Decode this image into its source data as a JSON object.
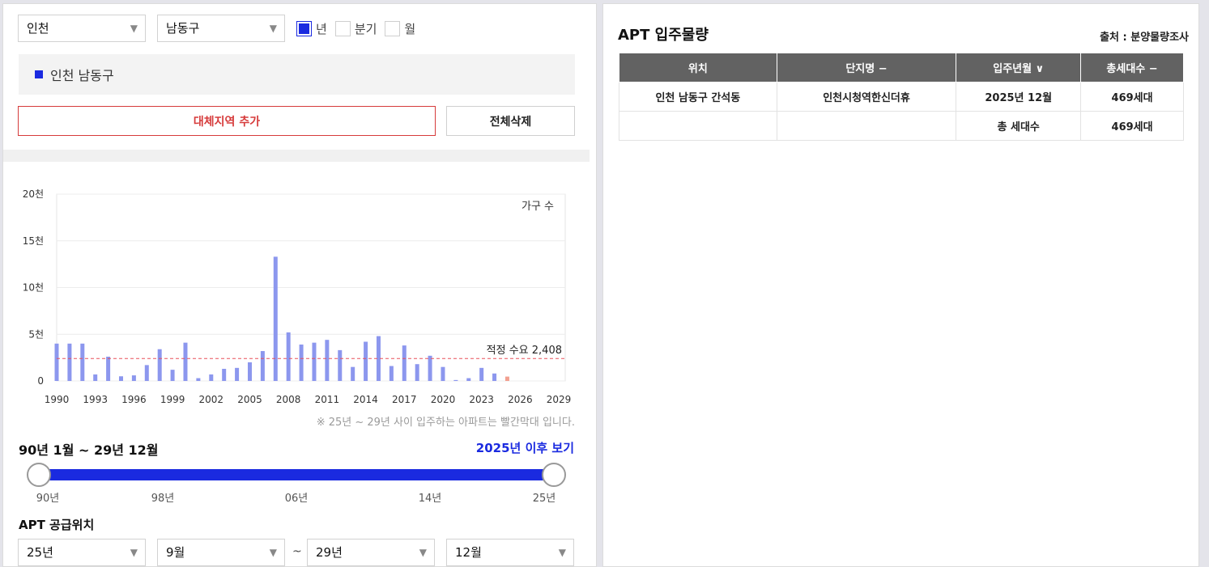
{
  "filters": {
    "city": "인천",
    "district": "남동구",
    "period_options": [
      {
        "label": "년",
        "checked": true
      },
      {
        "label": "분기",
        "checked": false
      },
      {
        "label": "월",
        "checked": false
      }
    ]
  },
  "region_tag": "인천 남동구",
  "buttons": {
    "add_region": "대체지역 추가",
    "delete_all": "전체삭제"
  },
  "chart_data": {
    "type": "bar",
    "legend_label": "가구 수",
    "ylim": [
      0,
      20000
    ],
    "y_ticks": [
      {
        "value": 0,
        "label": "0"
      },
      {
        "value": 5000,
        "label": "5천"
      },
      {
        "value": 10000,
        "label": "10천"
      },
      {
        "value": 15000,
        "label": "15천"
      },
      {
        "value": 20000,
        "label": "20천"
      }
    ],
    "x_tick_labels": [
      "1990",
      "1993",
      "1996",
      "1999",
      "2002",
      "2005",
      "2008",
      "2011",
      "2014",
      "2017",
      "2020",
      "2023",
      "2026",
      "2029"
    ],
    "x": [
      1990,
      1991,
      1992,
      1993,
      1994,
      1995,
      1996,
      1997,
      1998,
      1999,
      2000,
      2001,
      2002,
      2003,
      2004,
      2005,
      2006,
      2007,
      2008,
      2009,
      2010,
      2011,
      2012,
      2013,
      2014,
      2015,
      2016,
      2017,
      2018,
      2019,
      2020,
      2021,
      2022,
      2023,
      2024,
      2025
    ],
    "values": [
      4000,
      4000,
      4000,
      700,
      2600,
      500,
      600,
      1700,
      3400,
      1200,
      4100,
      300,
      700,
      1300,
      1400,
      2000,
      3200,
      13300,
      5200,
      3900,
      4100,
      4400,
      3300,
      1500,
      4200,
      4800,
      1600,
      3800,
      1800,
      2700,
      1500,
      100,
      300,
      1400,
      800,
      469
    ],
    "highlight_from": 2025,
    "colors": {
      "bar": "#8c97ee",
      "highlight": "#f2a090",
      "demand_line": "#e8505a"
    },
    "demand_line": {
      "value": 2408,
      "label": "적정 수요 2,408"
    },
    "grid": true
  },
  "note": "※ 25년 ~ 29년 사이 입주하는 아파트는 빨간막대 입니다.",
  "period_range": "90년 1월 ~ 29년 12월",
  "after_link": "2025년 이후 보기",
  "slider": {
    "labels": [
      "90년",
      "98년",
      "06년",
      "14년",
      "25년"
    ],
    "start": 0,
    "end": 1
  },
  "supply_section": {
    "title": "APT 공급위치",
    "from_year": "25년",
    "from_month": "9월",
    "tilde": "~",
    "to_year": "29년",
    "to_month": "12월"
  },
  "right_panel": {
    "title": "APT 입주물량",
    "source": "출처 : 분양물량조사",
    "table": {
      "headers": [
        "위치",
        "단지명 −",
        "입주년월 ∨",
        "총세대수 −"
      ],
      "rows": [
        [
          "인천 남동구 간석동",
          "인천시청역한신더휴",
          "2025년 12월",
          "469세대"
        ],
        [
          "",
          "",
          "총 세대수",
          "469세대"
        ]
      ]
    }
  },
  "icons": {
    "dropdown": "▼"
  }
}
